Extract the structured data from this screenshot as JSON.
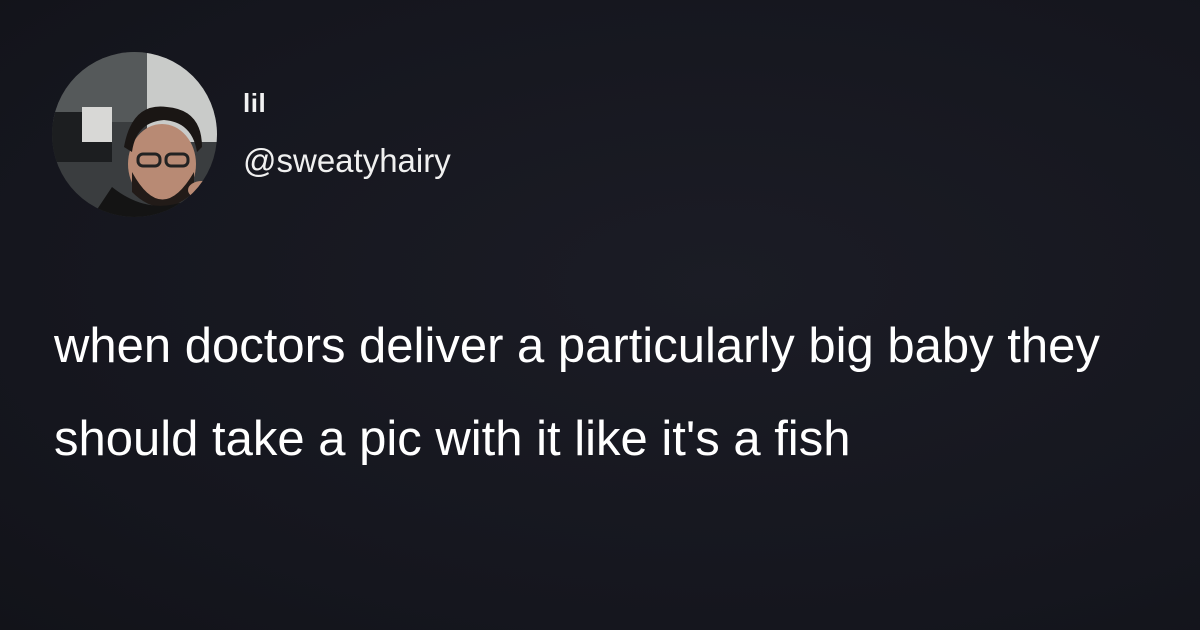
{
  "tweet": {
    "avatar_icon": "user-avatar-photo",
    "display_name": "lil",
    "handle": "@sweatyhairy",
    "text": "when doctors deliver a particularly big baby they should take a pic with it like it's a fish"
  },
  "colors": {
    "background": "#16171f",
    "text": "#ffffff"
  }
}
